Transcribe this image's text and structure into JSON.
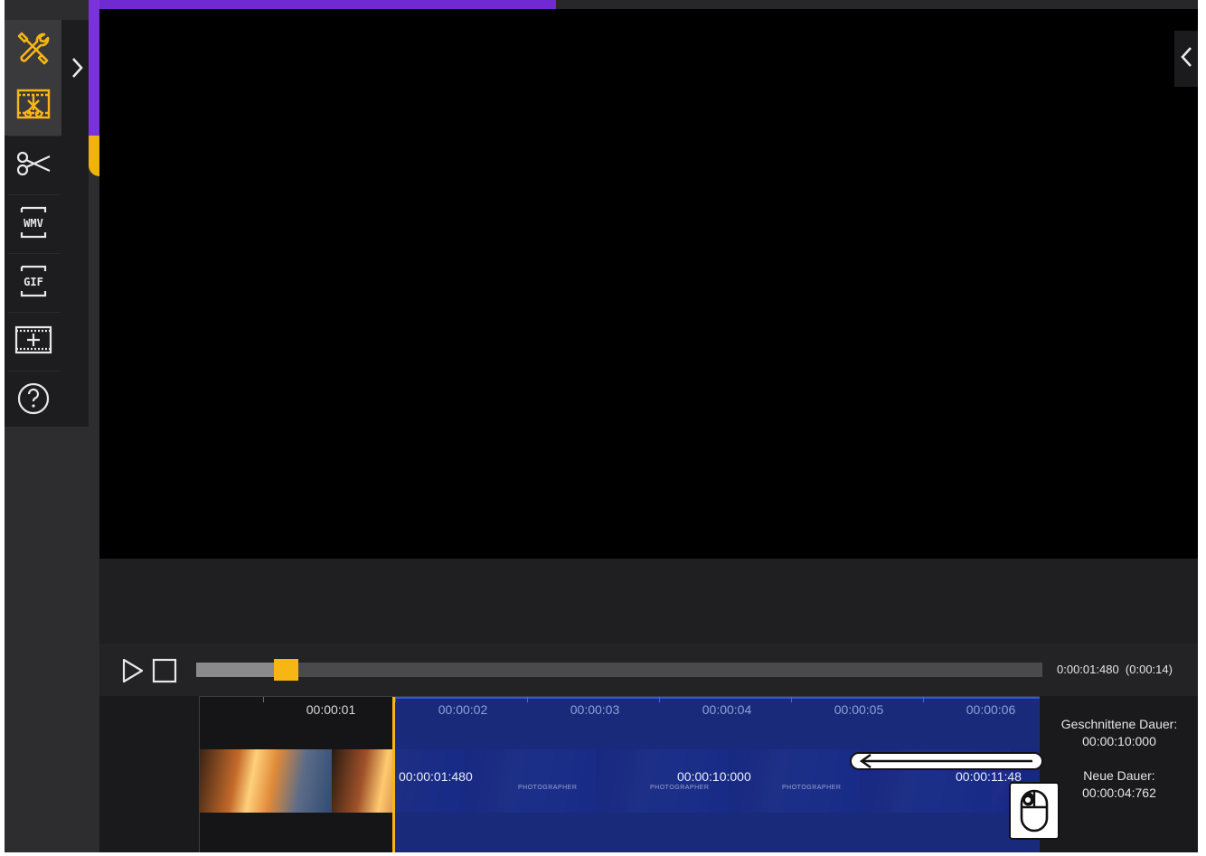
{
  "toolbar": {
    "tools": [
      {
        "name": "tools-icon",
        "active": true
      },
      {
        "name": "trim-icon",
        "active": true
      },
      {
        "name": "scissors-icon",
        "active": false
      },
      {
        "name": "wmv-export-icon",
        "label": "WMV",
        "active": false
      },
      {
        "name": "gif-export-icon",
        "label": "GIF",
        "active": false
      },
      {
        "name": "add-frame-icon",
        "active": false
      },
      {
        "name": "help-icon",
        "active": false
      }
    ]
  },
  "playback": {
    "current_time": "0:00:01:480",
    "total_time": "(0:00:14)",
    "position_fraction": 0.106
  },
  "timeline": {
    "ruler_labels": [
      "00:00:01",
      "00:00:02",
      "00:00:03",
      "00:00:04",
      "00:00:05",
      "00:00:06"
    ],
    "markers": {
      "start": "00:00:01:480",
      "middle": "00:00:10:000",
      "end": "00:00:11:48"
    },
    "watermark": "PHOTOGRAPHER"
  },
  "info": {
    "cut_duration_label": "Geschnittene Dauer:",
    "cut_duration_value": "00:00:10:000",
    "new_duration_label": "Neue Dauer:",
    "new_duration_value": "00:00:04:762"
  },
  "colors": {
    "accent": "#f7b614",
    "brand_purple": "#6f2bd1",
    "selection_blue": "#1a2c82"
  }
}
